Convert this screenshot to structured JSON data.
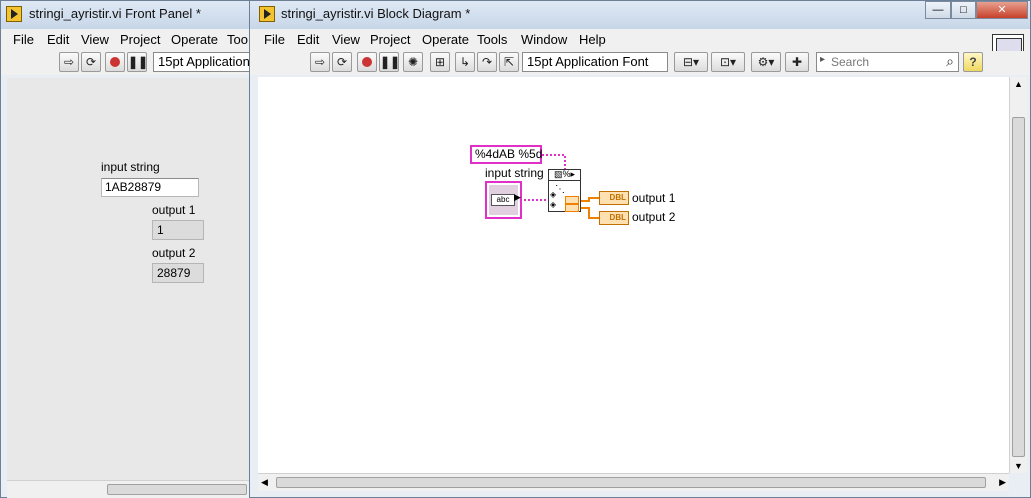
{
  "front_panel": {
    "title": "stringi_ayristir.vi Front Panel *",
    "menu": [
      "File",
      "Edit",
      "View",
      "Project",
      "Operate",
      "Too"
    ],
    "font_selector": "15pt Application",
    "controls": {
      "input_label": "input string",
      "input_value": "1AB28879",
      "output1_label": "output 1",
      "output1_value": "1",
      "output2_label": "output 2",
      "output2_value": "28879"
    }
  },
  "block_diagram": {
    "title": "stringi_ayristir.vi Block Diagram *",
    "menu": [
      "File",
      "Edit",
      "View",
      "Project",
      "Operate",
      "Tools",
      "Window",
      "Help"
    ],
    "font_selector": "15pt Application Font",
    "search_placeholder": "Search",
    "format_constant": "%4dAB %5d",
    "input_label": "input string",
    "input_terminal": "abc",
    "output1_label": "output 1",
    "output2_label": "output 2",
    "dbl_tag": "DBL",
    "wire_colors": {
      "string": "#e030c8",
      "numeric": "#f08000"
    }
  },
  "window_controls": {
    "minimize": "—",
    "maximize": "□",
    "close": "✕"
  },
  "help_button": "?"
}
